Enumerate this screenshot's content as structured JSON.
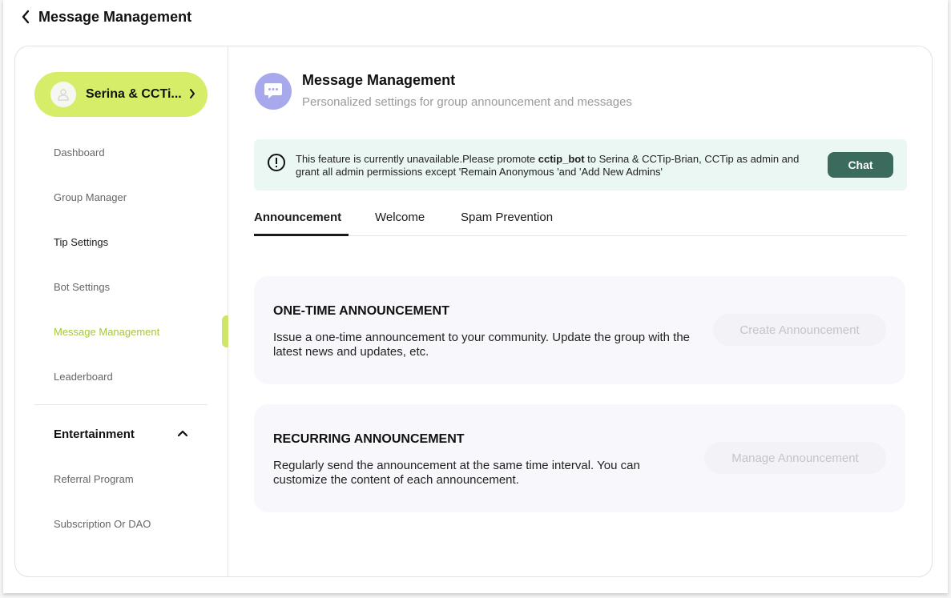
{
  "header": {
    "title": "Message Management"
  },
  "sidebar": {
    "group_name": "Serina & CCTi...",
    "items": [
      {
        "label": "Dashboard"
      },
      {
        "label": "Group Manager"
      },
      {
        "label": "Tip Settings"
      },
      {
        "label": "Bot Settings"
      },
      {
        "label": "Message Management"
      },
      {
        "label": "Leaderboard"
      }
    ],
    "section": "Entertainment",
    "section_items": [
      {
        "label": "Referral Program"
      },
      {
        "label": "Subscription Or DAO"
      }
    ],
    "accent_color": "#d6ed6a"
  },
  "main": {
    "title": "Message Management",
    "subtitle": "Personalized settings for group announcement and messages",
    "banner": {
      "text_before": "This feature is currently unavailable.Please promote ",
      "bot_name": "cctip_bot",
      "text_after": " to Serina & CCTip-Brian, CCTip as admin and grant all admin permissions except 'Remain Anonymous 'and 'Add New Admins'",
      "button": "Chat"
    },
    "tabs": [
      {
        "label": "Announcement"
      },
      {
        "label": "Welcome"
      },
      {
        "label": "Spam Prevention"
      }
    ],
    "cards": [
      {
        "title": "ONE-TIME ANNOUNCEMENT",
        "description": "Issue a one-time announcement to your community. Update the group with the latest news and updates, etc.",
        "button": "Create Announcement"
      },
      {
        "title": "RECURRING ANNOUNCEMENT",
        "description": "Regularly send the announcement at the same time interval. You can customize the content of each announcement.",
        "button": "Manage Announcement"
      }
    ]
  }
}
